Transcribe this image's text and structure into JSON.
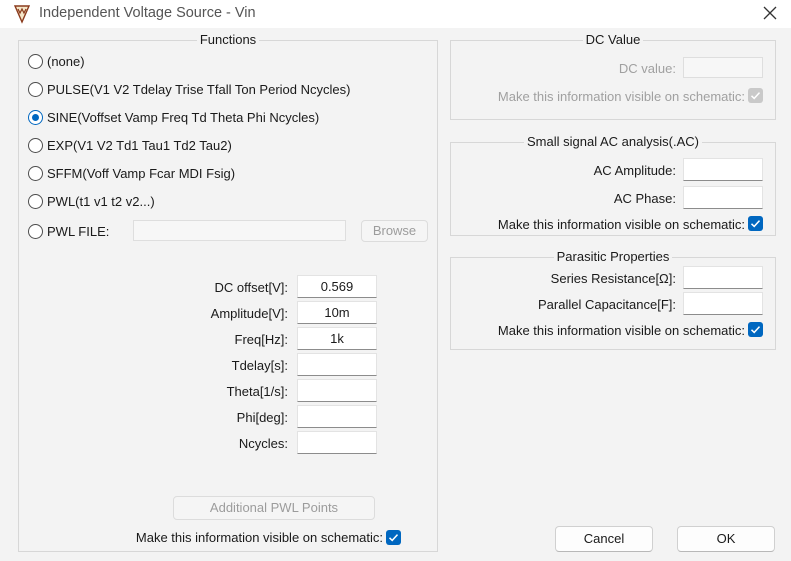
{
  "window": {
    "title": "Independent Voltage Source - Vin"
  },
  "functions": {
    "title": "Functions",
    "options": [
      {
        "label": "(none)",
        "checked": false
      },
      {
        "label": "PULSE(V1 V2 Tdelay Trise Tfall Ton Period Ncycles)",
        "checked": false
      },
      {
        "label": "SINE(Voffset Vamp Freq Td Theta Phi Ncycles)",
        "checked": true
      },
      {
        "label": "EXP(V1 V2 Td1 Tau1 Td2 Tau2)",
        "checked": false
      },
      {
        "label": "SFFM(Voff Vamp Fcar MDI Fsig)",
        "checked": false
      },
      {
        "label": "PWL(t1 v1 t2 v2...)",
        "checked": false
      },
      {
        "label": "PWL FILE:",
        "checked": false
      }
    ],
    "pwl_file_value": "",
    "browse_label": "Browse",
    "params": [
      {
        "label": "DC offset[V]:",
        "value": "0.569"
      },
      {
        "label": "Amplitude[V]:",
        "value": "10m"
      },
      {
        "label": "Freq[Hz]:",
        "value": "1k"
      },
      {
        "label": "Tdelay[s]:",
        "value": ""
      },
      {
        "label": "Theta[1/s]:",
        "value": ""
      },
      {
        "label": "Phi[deg]:",
        "value": ""
      },
      {
        "label": "Ncycles:",
        "value": ""
      }
    ],
    "additional_pwl_label": "Additional PWL Points",
    "visible_label": "Make this information visible on schematic:",
    "visible_checked": true
  },
  "dc_value": {
    "title": "DC Value",
    "label": "DC value:",
    "value": "",
    "visible_label": "Make this information visible on schematic:",
    "visible_checked": true,
    "disabled": true
  },
  "ac_analysis": {
    "title": "Small signal AC analysis(.AC)",
    "amplitude_label": "AC Amplitude:",
    "amplitude_value": "",
    "phase_label": "AC Phase:",
    "phase_value": "",
    "visible_label": "Make this information visible on schematic:",
    "visible_checked": true
  },
  "parasitic": {
    "title": "Parasitic Properties",
    "resistance_label": "Series Resistance[Ω]:",
    "resistance_value": "",
    "capacitance_label": "Parallel Capacitance[F]:",
    "capacitance_value": "",
    "visible_label": "Make this information visible on schematic:",
    "visible_checked": true
  },
  "buttons": {
    "cancel": "Cancel",
    "ok": "OK"
  },
  "colors": {
    "accent": "#0067c0",
    "dialog_bg": "#f3f3f3"
  }
}
